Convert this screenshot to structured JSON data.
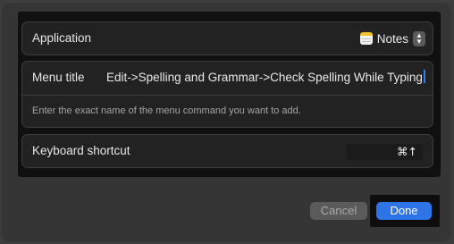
{
  "dialog": {
    "application": {
      "label": "Application",
      "selected_app": "Notes",
      "app_icon": "notes-app-icon",
      "stepper_icon": "up-down-chevron-icon"
    },
    "menu_title": {
      "label": "Menu title",
      "value": "Edit->Spelling and Grammar->Check Spelling While Typing",
      "help_text": "Enter the exact name of the menu command you want to add."
    },
    "keyboard_shortcut": {
      "label": "Keyboard shortcut",
      "value": "⌘↑"
    },
    "buttons": {
      "cancel_label": "Cancel",
      "done_label": "Done"
    },
    "colors": {
      "accent": "#2f74e6",
      "caret": "#2f7bf6"
    }
  }
}
